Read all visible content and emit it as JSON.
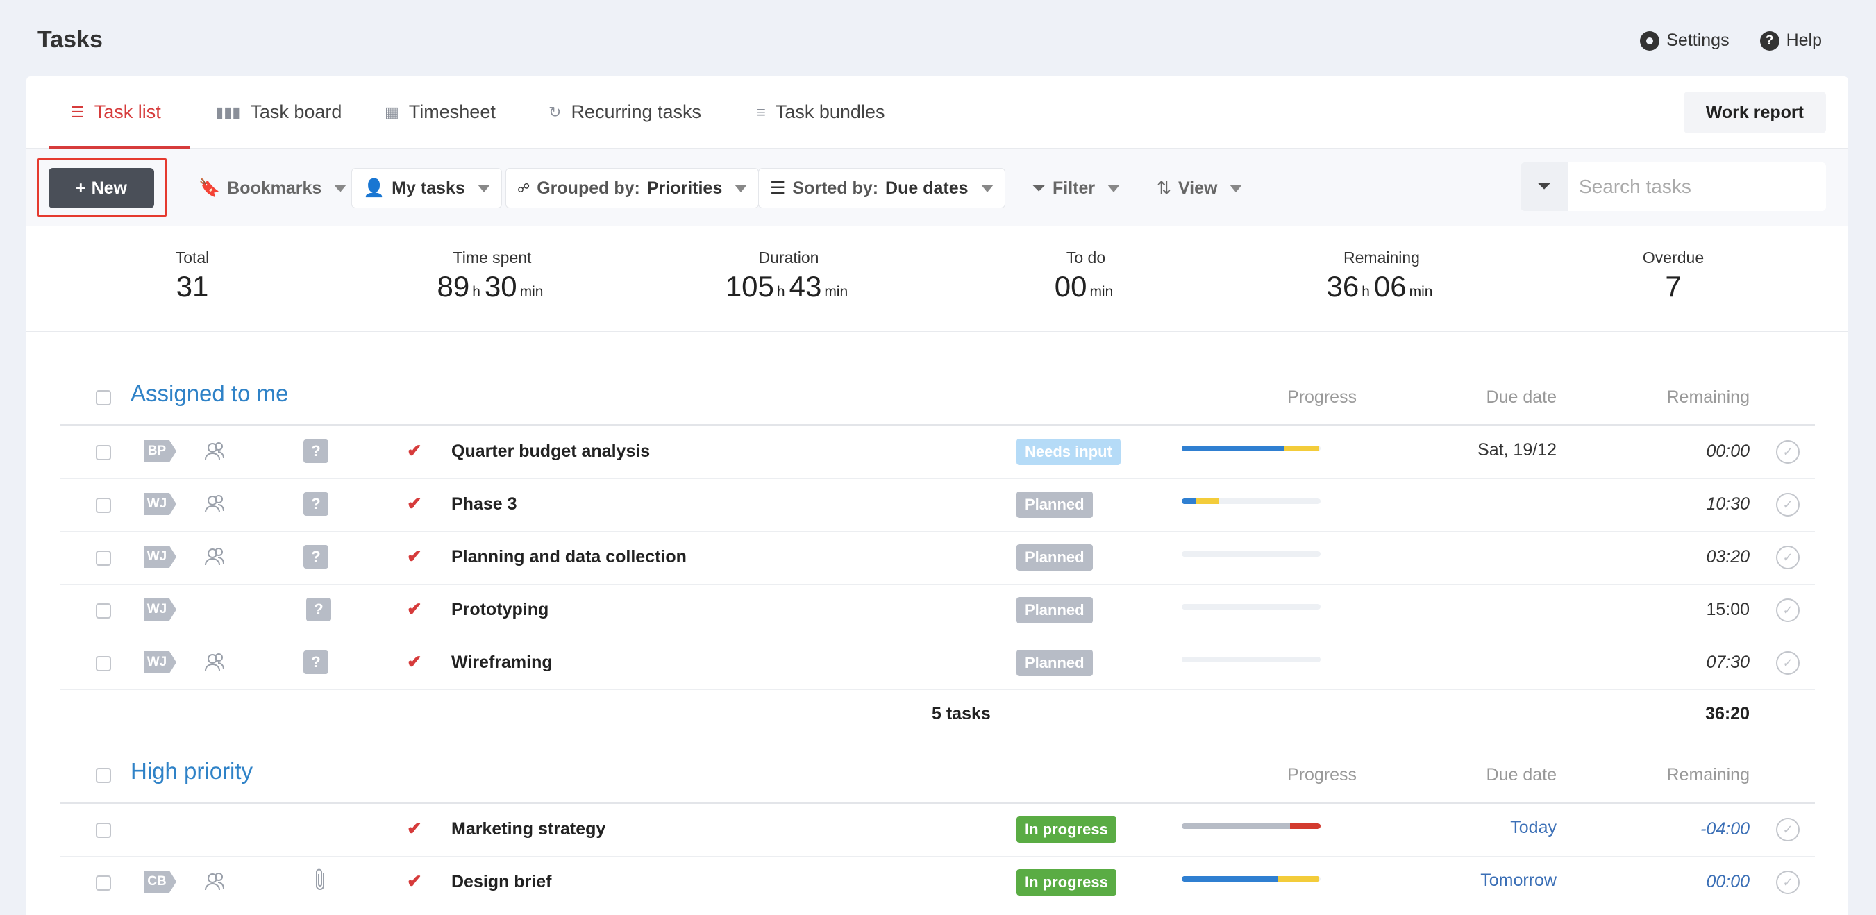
{
  "page": {
    "title": "Tasks"
  },
  "top_links": {
    "settings": "Settings",
    "help": "Help",
    "help_glyph": "?"
  },
  "tabs": [
    {
      "label": "Task list",
      "icon": "list-icon",
      "active": true
    },
    {
      "label": "Task board",
      "icon": "board-icon"
    },
    {
      "label": "Timesheet",
      "icon": "grid-icon"
    },
    {
      "label": "Recurring tasks",
      "icon": "refresh-icon"
    },
    {
      "label": "Task bundles",
      "icon": "stack-icon"
    }
  ],
  "work_report": "Work report",
  "toolbar": {
    "new_label": "New",
    "bookmarks": "Bookmarks",
    "my_tasks": "My tasks",
    "grouped_prefix": "Grouped by:",
    "grouped_value": "Priorities",
    "sorted_prefix": "Sorted by:",
    "sorted_value": "Due dates",
    "filter": "Filter",
    "view": "View",
    "search_placeholder": "Search tasks"
  },
  "stats": {
    "total": {
      "label": "Total",
      "value": "31"
    },
    "time_spent": {
      "label": "Time spent",
      "h": "89",
      "min": "30"
    },
    "duration": {
      "label": "Duration",
      "h": "105",
      "min": "43"
    },
    "todo": {
      "label": "To do",
      "min": "00"
    },
    "remaining": {
      "label": "Remaining",
      "h": "36",
      "min": "06"
    },
    "overdue": {
      "label": "Overdue",
      "value": "7"
    },
    "unit_h": "h",
    "unit_min": "min"
  },
  "columns": {
    "progress": "Progress",
    "due": "Due date",
    "remaining": "Remaining"
  },
  "colors": {
    "accent": "#d63b3b",
    "group_title": "#2f82c7",
    "blue": "#2f7fd1",
    "yellow": "#f3cc3a",
    "gray": "#b7bcc6",
    "red": "#d33b2f",
    "needs_input": "#b5dbf7",
    "planned": "#b7bcc6",
    "in_progress": "#5aac44"
  },
  "groups": [
    {
      "title": "Assigned to me",
      "tasks": [
        {
          "tag": "BP",
          "name": "Quarter budget analysis",
          "status": "Needs input",
          "status_color": "#b5dbf7",
          "progress": [
            {
              "color": "#2f7fd1",
              "frac": 0.74
            },
            {
              "color": "#f3cc3a",
              "frac": 0.25
            }
          ],
          "due": "Sat, 19/12",
          "remaining": "00:00",
          "rem_style": "italic"
        },
        {
          "tag": "WJ",
          "name": "Phase 3",
          "status": "Planned",
          "status_color": "#b7bcc6",
          "progress": [
            {
              "color": "#2f7fd1",
              "frac": 0.1
            },
            {
              "color": "#f3cc3a",
              "frac": 0.17
            }
          ],
          "due": "",
          "remaining": "10:30",
          "rem_style": "italic"
        },
        {
          "tag": "WJ",
          "name": "Planning and data collection",
          "status": "Planned",
          "status_color": "#b7bcc6",
          "progress": [],
          "due": "",
          "remaining": "03:20",
          "rem_style": "italic"
        },
        {
          "tag": "WJ",
          "name": "Prototyping",
          "status": "Planned",
          "status_color": "#b7bcc6",
          "progress": [],
          "due": "",
          "remaining": "15:00",
          "rem_style": "plain"
        },
        {
          "tag": "WJ",
          "name": "Wireframing",
          "status": "Planned",
          "status_color": "#b7bcc6",
          "progress": [],
          "due": "",
          "remaining": "07:30",
          "rem_style": "italic"
        }
      ],
      "summary": {
        "count": "5 tasks",
        "total": "36:20"
      }
    },
    {
      "title": "High priority",
      "tasks": [
        {
          "tag": "",
          "name": "Marketing strategy",
          "status": "In progress",
          "status_color": "#5aac44",
          "progress": [
            {
              "color": "#b7bcc6",
              "frac": 0.78
            },
            {
              "color": "#d33b2f",
              "frac": 0.22
            }
          ],
          "due": "Today",
          "remaining": "-04:00",
          "rem_style": "italic-blue"
        },
        {
          "tag": "CB",
          "name": "Design brief",
          "status": "In progress",
          "status_color": "#5aac44",
          "progress": [
            {
              "color": "#2f7fd1",
              "frac": 0.69
            },
            {
              "color": "#f3cc3a",
              "frac": 0.3
            }
          ],
          "due": "Tomorrow",
          "remaining": "00:00",
          "rem_style": "italic-blue"
        }
      ]
    }
  ]
}
